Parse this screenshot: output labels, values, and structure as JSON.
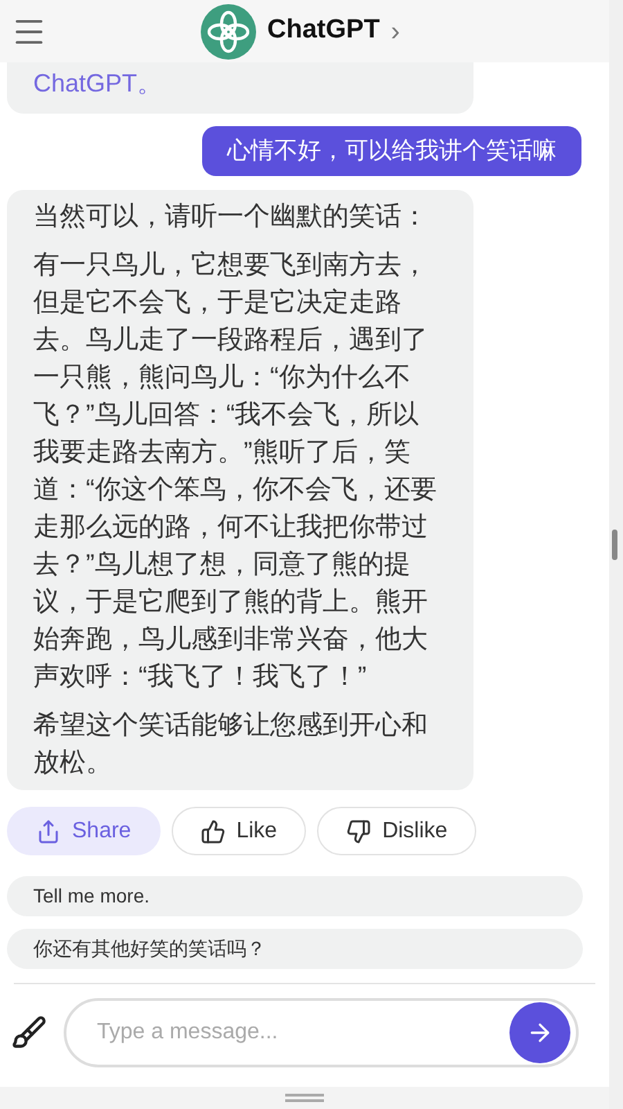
{
  "header": {
    "title": "ChatGPT",
    "chevron": "›"
  },
  "previous_message_tail": "ChatGPT。",
  "messages": [
    {
      "kind": "user",
      "paragraphs": [
        "心情不好，可以给我讲个笑话嘛"
      ]
    },
    {
      "kind": "assistant",
      "paragraphs": [
        "当然可以，请听一个幽默的笑话：",
        "有一只鸟儿，它想要飞到南方去，但是它不会飞，于是它决定走路去。鸟儿走了一段路程后，遇到了一只熊，熊问鸟儿：“你为什么不飞？”鸟儿回答：“我不会飞，所以我要走路去南方。”熊听了后，笑道：“你这个笨鸟，你不会飞，还要走那么远的路，何不让我把你带过去？”鸟儿想了想，同意了熊的提议，于是它爬到了熊的背上。熊开始奔跑，鸟儿感到非常兴奋，他大声欢呼：“我飞了！我飞了！”",
        "希望这个笑话能够让您感到开心和放松。"
      ]
    }
  ],
  "actions": [
    {
      "kind": "share",
      "label": "Share",
      "selected": true
    },
    {
      "kind": "like",
      "label": "Like",
      "selected": false
    },
    {
      "kind": "dislike",
      "label": "Dislike",
      "selected": false
    }
  ],
  "suggestions": [
    "Tell me more.",
    "你还有其他好笑的笑话吗？"
  ],
  "composer": {
    "placeholder": "Type a message..."
  }
}
